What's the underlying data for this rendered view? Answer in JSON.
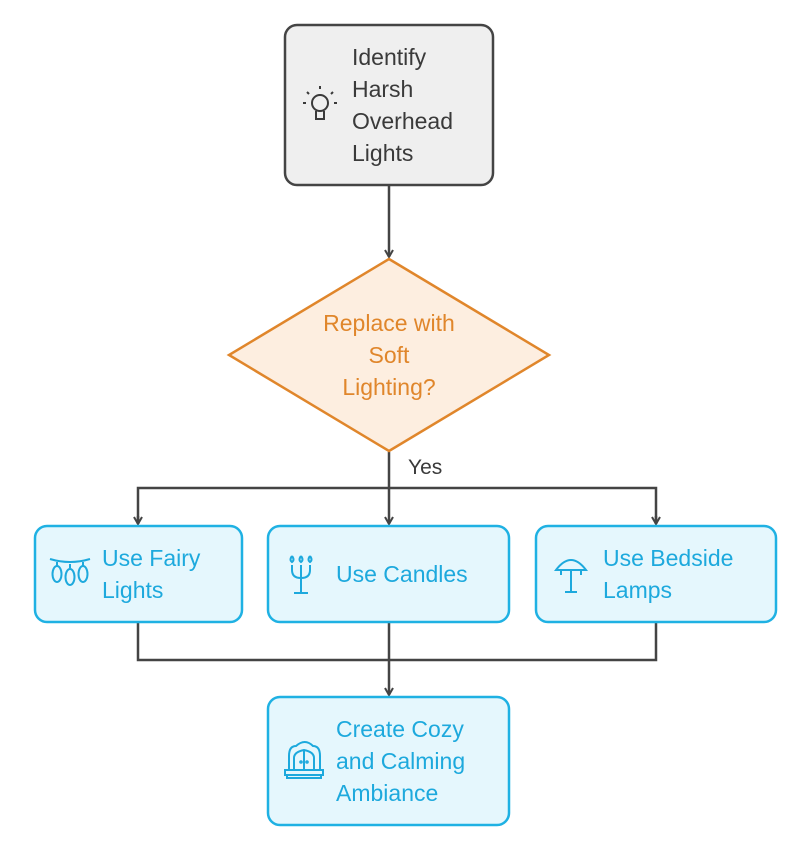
{
  "colors": {
    "start_fill": "#efefef",
    "start_stroke": "#444444",
    "decision_fill": "#fdeee0",
    "decision_stroke": "#e0862b",
    "option_fill": "#e5f7fd",
    "option_stroke": "#1fb1e3",
    "connector": "#444444"
  },
  "nodes": {
    "start": {
      "label": "Identify\nHarsh\nOverhead\nLights",
      "icon": "lightbulb-icon"
    },
    "decision": {
      "label": "Replace with\nSoft\nLighting?"
    },
    "fairy": {
      "label": "Use Fairy\nLights",
      "icon": "fairy-lights-icon"
    },
    "candles": {
      "label": "Use Candles",
      "icon": "candelabra-icon"
    },
    "lamps": {
      "label": "Use Bedside\nLamps",
      "icon": "lamp-icon"
    },
    "result": {
      "label": "Create Cozy\nand Calming\nAmbiance",
      "icon": "window-icon"
    }
  },
  "edges": {
    "yes_label": "Yes"
  }
}
